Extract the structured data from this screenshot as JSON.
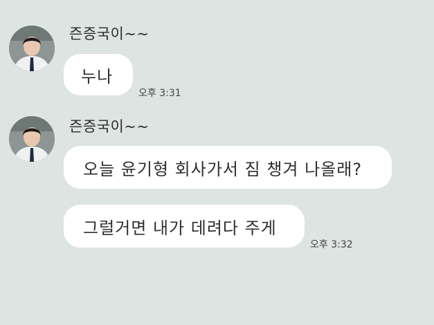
{
  "chat": {
    "groups": [
      {
        "sender": "즌증국이~~",
        "avatar_icon": "profile-photo",
        "messages": [
          {
            "text": "누나",
            "time": "오후 3:31"
          }
        ]
      },
      {
        "sender": "즌증국이~~",
        "avatar_icon": "profile-photo",
        "messages": [
          {
            "text": "오늘 윤기형 회사가서 짐 챙겨 나올래?",
            "time": ""
          },
          {
            "text": "그럴거면 내가 데려다 주게",
            "time": "오후 3:32"
          }
        ]
      }
    ]
  },
  "colors": {
    "background": "#dde4e1",
    "bubble": "#ffffff"
  }
}
